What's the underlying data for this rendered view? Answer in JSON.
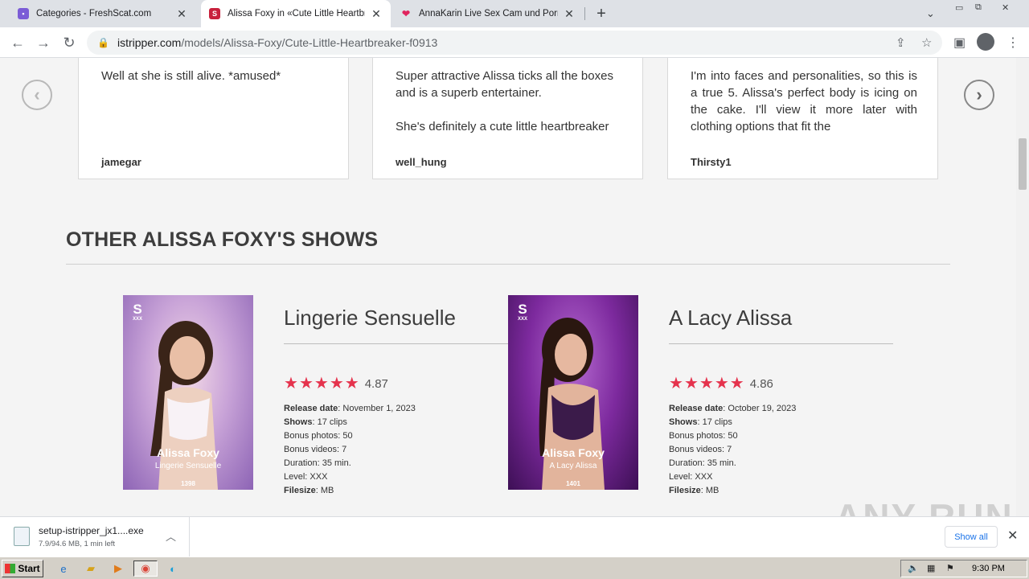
{
  "browser": {
    "tabs": [
      {
        "title": "Categories - FreshScat.com",
        "icon": "purple-page-icon"
      },
      {
        "title": "Alissa Foxy in «Cute Little Heartbreaker»",
        "icon": "istripper-s-icon"
      },
      {
        "title": "AnnaKarin Live Sex Cam und Porno Chat",
        "icon": "pink-lips-icon"
      }
    ],
    "url_host": "istripper.com",
    "url_path": "/models/Alissa-Foxy/Cute-Little-Heartbreaker-f0913"
  },
  "reviews": [
    {
      "paragraphs": [
        "Well at she is still alive. *amused*"
      ],
      "author": "jamegar"
    },
    {
      "paragraphs": [
        "Super attractive Alissa ticks all the boxes and is a superb entertainer.",
        "She's definitely a cute little heartbreaker"
      ],
      "author": "well_hung"
    },
    {
      "paragraphs": [
        "I'm into faces and personalities, so this is a true 5. Alissa's perfect body is icing on the cake. I'll view it more later with clothing options that fit the"
      ],
      "author": "Thirsty1"
    }
  ],
  "section": {
    "title": "OTHER ALISSA FOXY'S SHOWS"
  },
  "shows": [
    {
      "title": "Lingerie Sensuelle",
      "rating": "4.87",
      "stars": 5,
      "poster": {
        "logo": "S",
        "logo_sub": "XXX",
        "name": "Alissa Foxy",
        "subtitle": "Lingerie Sensuelle",
        "number": "1398"
      },
      "meta": [
        {
          "label": "Release date",
          "value": "November 1, 2023"
        },
        {
          "label": "Shows",
          "value": "17 clips"
        },
        {
          "label": "Bonus photos",
          "value": "50"
        },
        {
          "label": "Bonus videos",
          "value": "7"
        },
        {
          "label": "Duration",
          "value": "35 min."
        },
        {
          "label": "Level",
          "value": "XXX"
        },
        {
          "label": "Filesize",
          "value": "MB"
        }
      ]
    },
    {
      "title": "A Lacy Alissa",
      "rating": "4.86",
      "stars": 5,
      "poster": {
        "logo": "S",
        "logo_sub": "XXX",
        "name": "Alissa Foxy",
        "subtitle": "A Lacy Alissa",
        "number": "1401"
      },
      "meta": [
        {
          "label": "Release date",
          "value": "October 19, 2023"
        },
        {
          "label": "Shows",
          "value": "17 clips"
        },
        {
          "label": "Bonus photos",
          "value": "50"
        },
        {
          "label": "Bonus videos",
          "value": "7"
        },
        {
          "label": "Duration",
          "value": "35 min."
        },
        {
          "label": "Level",
          "value": "XXX"
        },
        {
          "label": "Filesize",
          "value": "MB"
        }
      ]
    }
  ],
  "download": {
    "filename": "setup-istripper_jx1....exe",
    "status": "7.9/94.6 MB, 1 min left",
    "show_all": "Show all"
  },
  "watermark": "ANY RUN",
  "taskbar": {
    "start": "Start",
    "clock": "9:30 PM"
  },
  "colors": {
    "accent": "#e5334d",
    "page_bg": "#f4f4f4",
    "link_blue": "#1a73e8"
  }
}
